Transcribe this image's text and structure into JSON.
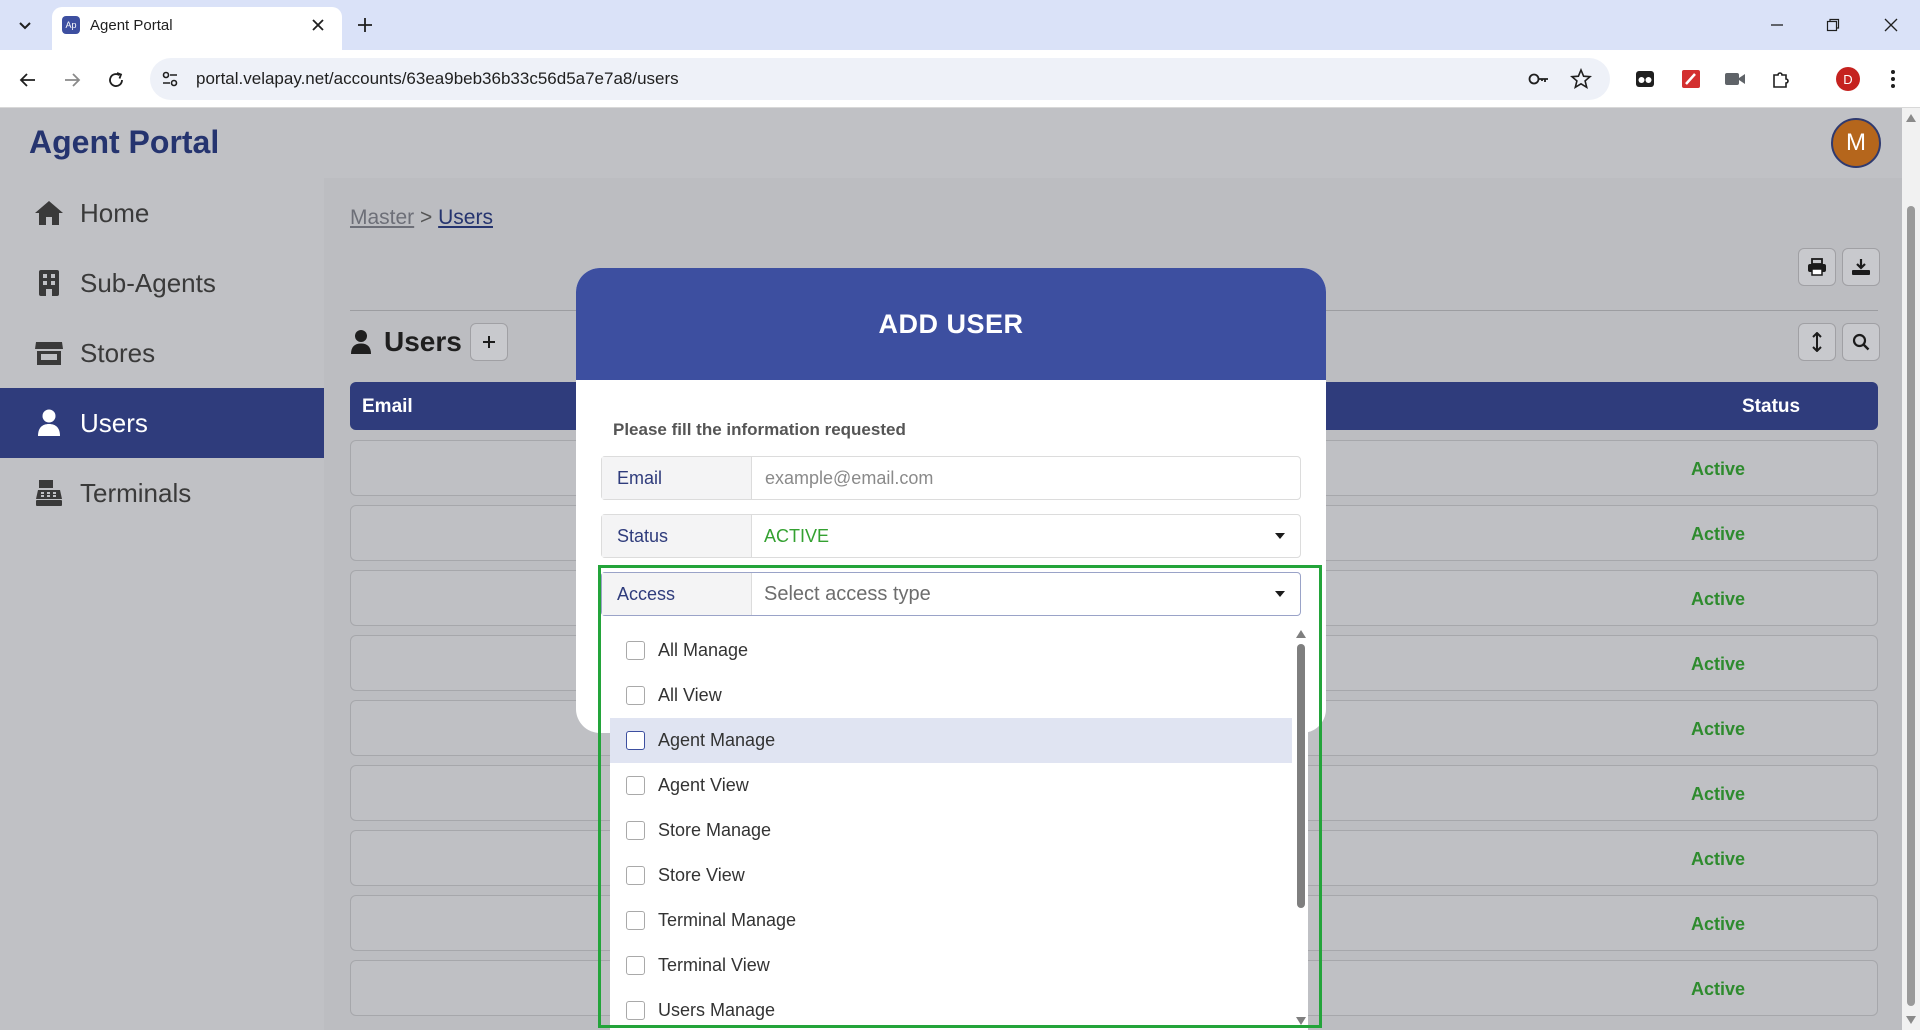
{
  "browser": {
    "tab_title": "Agent Portal",
    "favicon_text": "Ap",
    "url": "portal.velapay.net/accounts/63ea9beb36b33c56d5a7e7a8/users",
    "profile_initial": "D"
  },
  "app": {
    "logo": "Agent Portal",
    "avatar_initial": "M"
  },
  "sidebar": {
    "items": [
      {
        "label": "Home",
        "icon": "home-icon"
      },
      {
        "label": "Sub-Agents",
        "icon": "building-icon"
      },
      {
        "label": "Stores",
        "icon": "store-icon"
      },
      {
        "label": "Users",
        "icon": "user-icon",
        "active": true
      },
      {
        "label": "Terminals",
        "icon": "cash-register-icon"
      }
    ]
  },
  "breadcrumb": {
    "parent": "Master",
    "separator": ">",
    "current": "Users"
  },
  "users_section": {
    "heading": "Users",
    "columns": {
      "email": "Email",
      "status": "Status"
    },
    "rows": [
      {
        "status": "Active"
      },
      {
        "status": "Active"
      },
      {
        "status": "Active"
      },
      {
        "status": "Active"
      },
      {
        "status": "Active"
      },
      {
        "status": "Active"
      },
      {
        "status": "Active"
      },
      {
        "status": "Active"
      },
      {
        "status": "Active"
      }
    ]
  },
  "modal": {
    "title": "ADD USER",
    "instructions": "Please fill the information requested",
    "email": {
      "label": "Email",
      "placeholder": "example@email.com",
      "value": ""
    },
    "status": {
      "label": "Status",
      "value": "ACTIVE"
    },
    "access": {
      "label": "Access",
      "placeholder": "Select access type",
      "options": [
        {
          "label": "All Manage",
          "checked": false
        },
        {
          "label": "All View",
          "checked": false
        },
        {
          "label": "Agent Manage",
          "checked": false,
          "highlighted": true
        },
        {
          "label": "Agent View",
          "checked": false
        },
        {
          "label": "Store Manage",
          "checked": false
        },
        {
          "label": "Store View",
          "checked": false
        },
        {
          "label": "Terminal Manage",
          "checked": false
        },
        {
          "label": "Terminal View",
          "checked": false
        },
        {
          "label": "Users Manage",
          "checked": false
        }
      ]
    }
  },
  "colors": {
    "primary": "#3d4fa0",
    "sidebar_active": "#2f3c7c",
    "status_active": "#2e8b2e",
    "status_value": "#34a131",
    "focus_outline": "#23a43a"
  }
}
